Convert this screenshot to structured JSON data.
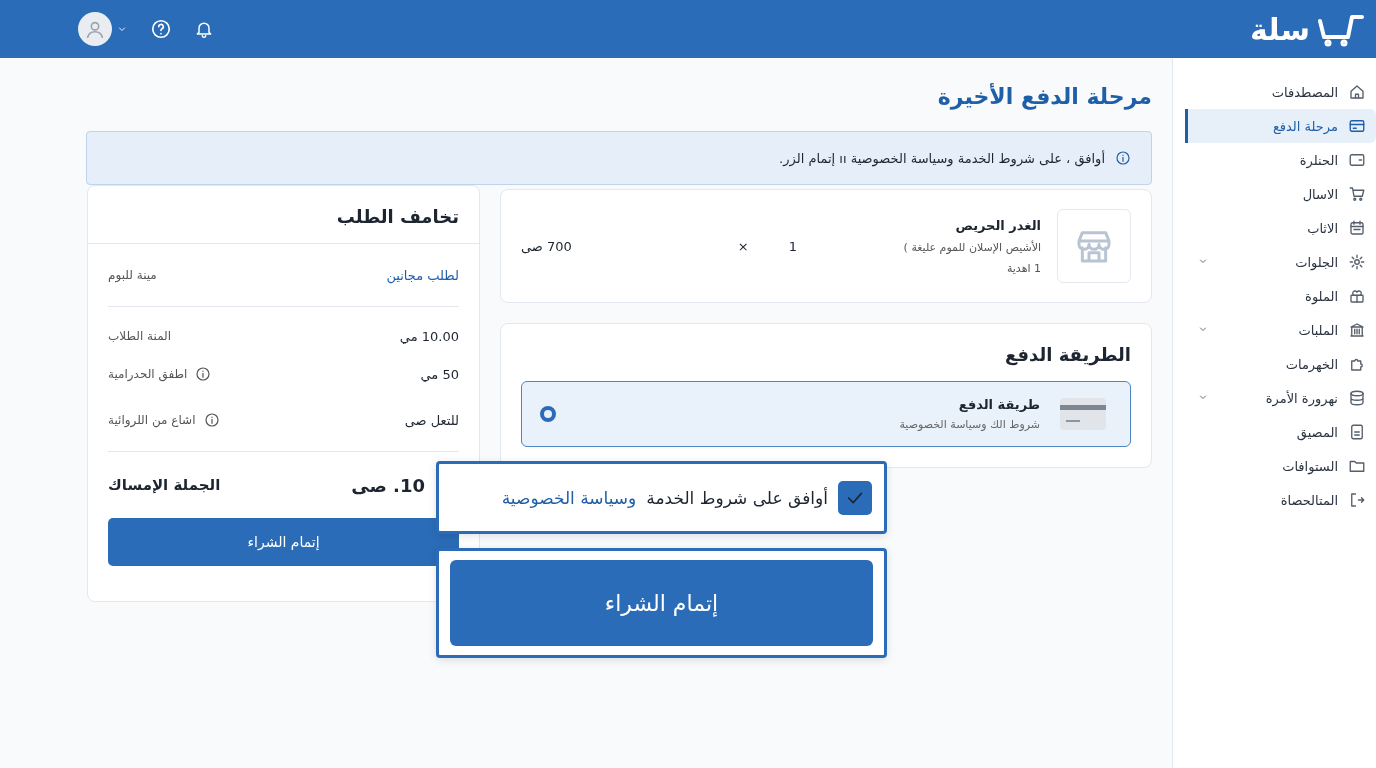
{
  "topbar": {
    "logo": "سلة"
  },
  "sidebar": {
    "items": [
      {
        "label": "المصطدفات",
        "kind": "home",
        "selected": false,
        "has_submenu": false
      },
      {
        "label": "مرحلة الدفع",
        "kind": "card",
        "selected": true,
        "has_submenu": false
      },
      {
        "label": "الحنلرة",
        "kind": "wallet",
        "selected": false,
        "has_submenu": false
      },
      {
        "label": "الاسال",
        "kind": "cart",
        "selected": false,
        "has_submenu": false
      },
      {
        "label": "الاثاب",
        "kind": "calendar",
        "selected": false,
        "has_submenu": false
      },
      {
        "label": "الجلوات",
        "kind": "gear",
        "selected": false,
        "has_submenu": true
      },
      {
        "label": "الملوة",
        "kind": "gift",
        "selected": false,
        "has_submenu": false
      },
      {
        "label": "الملبات",
        "kind": "building",
        "selected": false,
        "has_submenu": true
      },
      {
        "label": "الخهرمات",
        "kind": "puzzle",
        "selected": false,
        "has_submenu": false
      },
      {
        "label": "نهرورة الأمرة",
        "kind": "database",
        "selected": false,
        "has_submenu": true
      },
      {
        "label": "المصيق",
        "kind": "box",
        "selected": false,
        "has_submenu": false
      },
      {
        "label": "الستوافات",
        "kind": "folder",
        "selected": false,
        "has_submenu": false
      },
      {
        "label": "المتالحصاة",
        "kind": "logout",
        "selected": false,
        "has_submenu": false
      }
    ]
  },
  "page": {
    "title": "مرحلة الدفع الأخيرة",
    "notice": "أوافق ، على شروط الخدمة وسياسة الخصوصية ıı إتمام الزر."
  },
  "product": {
    "name": "الغدر الحريص",
    "description": "الأشيص الإسلان للموم عليغة )",
    "note": "1 اهدية",
    "quantity": "1",
    "times": "×",
    "price": "700 صى"
  },
  "payment": {
    "title": "الطريقة الدفع",
    "options": [
      {
        "title": "طريقة الدفع",
        "subtitle": "شروط الك وسياسة الخصوصية",
        "selected": true
      }
    ]
  },
  "summary": {
    "title": "تخامف الطلب",
    "link": "لطلب مجانين",
    "link_note": "مينة للبوم",
    "rows": [
      {
        "amount": "10.00 مي",
        "label": "المنة الطلاب",
        "info": false
      },
      {
        "amount": "50 مي",
        "label": "اطفق الحدرامية",
        "info": true
      },
      {
        "amount": "للتعل صى",
        "label": "اشاع من اللروائية",
        "info": true
      }
    ],
    "total_label": "الجملة الإمساك",
    "total_amount": "10. صى",
    "button": "إتمام الشراء"
  },
  "overlay": {
    "consent_text": "أوافق على شروط الخدمة",
    "consent_link": "وسياسة الخصوصية",
    "checked": true,
    "button": "إتمام الشراء"
  }
}
